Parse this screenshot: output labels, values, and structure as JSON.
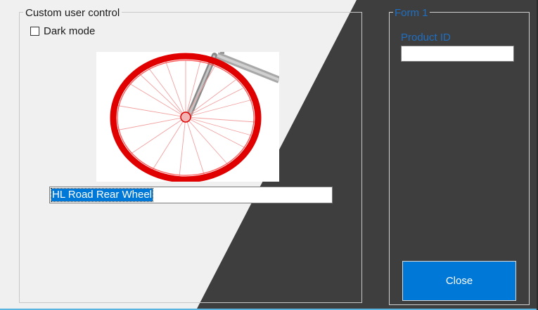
{
  "custom_control": {
    "group_title": "Custom user control",
    "dark_mode_label": "Dark mode",
    "dark_mode_checked": false,
    "product_name_value": "HL Road Rear Wheel"
  },
  "form1": {
    "group_title": "Form 1",
    "product_id_label": "Product ID",
    "product_id_value": "",
    "close_label": "Close"
  },
  "colors": {
    "accent": "#0078d7",
    "dark_background": "#3e3e3e",
    "light_background": "#f0f0f0",
    "label_blue": "#1e6fc2",
    "wheel_red": "#e00000"
  },
  "icons": {
    "product_image": "bicycle-rear-wheel-image"
  }
}
